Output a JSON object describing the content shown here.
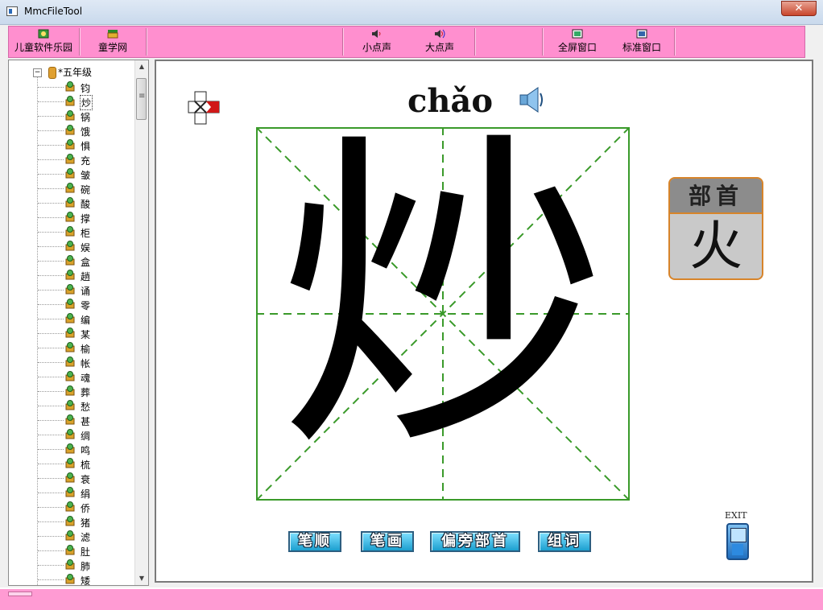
{
  "window": {
    "title": "MmcFileTool",
    "close_glyph": "✕"
  },
  "toolbar": {
    "buttons": [
      {
        "label": "儿童软件乐园",
        "icon": "kids-icon"
      },
      {
        "label": "童学网",
        "icon": "web-icon"
      },
      {
        "label": "小点声",
        "icon": "volume-low-icon"
      },
      {
        "label": "大点声",
        "icon": "volume-high-icon"
      },
      {
        "label": "全屏窗口",
        "icon": "fullscreen-icon"
      },
      {
        "label": "标准窗口",
        "icon": "standard-window-icon"
      }
    ]
  },
  "tree": {
    "expander": "−",
    "root_label": "*五年级",
    "items": [
      "钧",
      "炒",
      "锅",
      "饿",
      "惧",
      "充",
      "皱",
      "碗",
      "酸",
      "撑",
      "柜",
      "娱",
      "盒",
      "趟",
      "诵",
      "零",
      "编",
      "某",
      "榆",
      "帐",
      "魂",
      "葬",
      "愁",
      "甚",
      "绸",
      "鸣",
      "梳",
      "衰",
      "绢",
      "侨",
      "猪",
      "滤",
      "肚",
      "肺",
      "矮"
    ],
    "selected_index": 1
  },
  "main": {
    "pinyin": "chǎo",
    "character": "炒",
    "radical_title": "部首",
    "radical": "火",
    "buttons": {
      "stroke_order": "笔顺",
      "strokes": "笔画",
      "radical_parts": "偏旁部首",
      "words": "组词"
    },
    "exit_label": "EXIT"
  },
  "colors": {
    "toolbar_bg": "#ff8fcf",
    "grid_line": "#3a9a2a",
    "radical_border": "#d7842a",
    "button_blue": "#1c9fcf"
  }
}
